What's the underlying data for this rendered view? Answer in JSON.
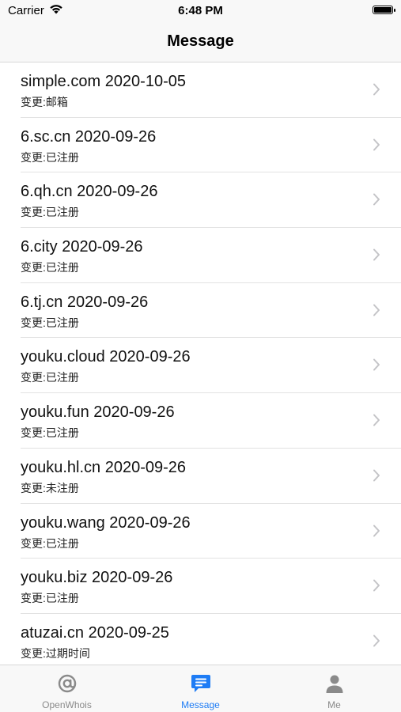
{
  "status_bar": {
    "carrier": "Carrier",
    "time": "6:48 PM"
  },
  "nav": {
    "title": "Message"
  },
  "messages": [
    {
      "title": "simple.com 2020-10-05",
      "subtitle": "变更:邮箱"
    },
    {
      "title": "6.sc.cn 2020-09-26",
      "subtitle": "变更:已注册"
    },
    {
      "title": "6.qh.cn 2020-09-26",
      "subtitle": "变更:已注册"
    },
    {
      "title": "6.city 2020-09-26",
      "subtitle": "变更:已注册"
    },
    {
      "title": "6.tj.cn 2020-09-26",
      "subtitle": "变更:已注册"
    },
    {
      "title": "youku.cloud 2020-09-26",
      "subtitle": "变更:已注册"
    },
    {
      "title": "youku.fun 2020-09-26",
      "subtitle": "变更:已注册"
    },
    {
      "title": "youku.hl.cn 2020-09-26",
      "subtitle": "变更:未注册"
    },
    {
      "title": "youku.wang 2020-09-26",
      "subtitle": "变更:已注册"
    },
    {
      "title": "youku.biz 2020-09-26",
      "subtitle": "变更:已注册"
    },
    {
      "title": "atuzai.cn 2020-09-25",
      "subtitle": "变更:过期时间"
    }
  ],
  "tabs": [
    {
      "label": "OpenWhois",
      "icon": "at-sign-icon",
      "active": false
    },
    {
      "label": "Message",
      "icon": "message-bubble-icon",
      "active": true
    },
    {
      "label": "Me",
      "icon": "person-icon",
      "active": false
    }
  ],
  "colors": {
    "accent": "#1e7cf5",
    "inactive": "#8a8a8a",
    "chevron": "#c4c4c7"
  }
}
